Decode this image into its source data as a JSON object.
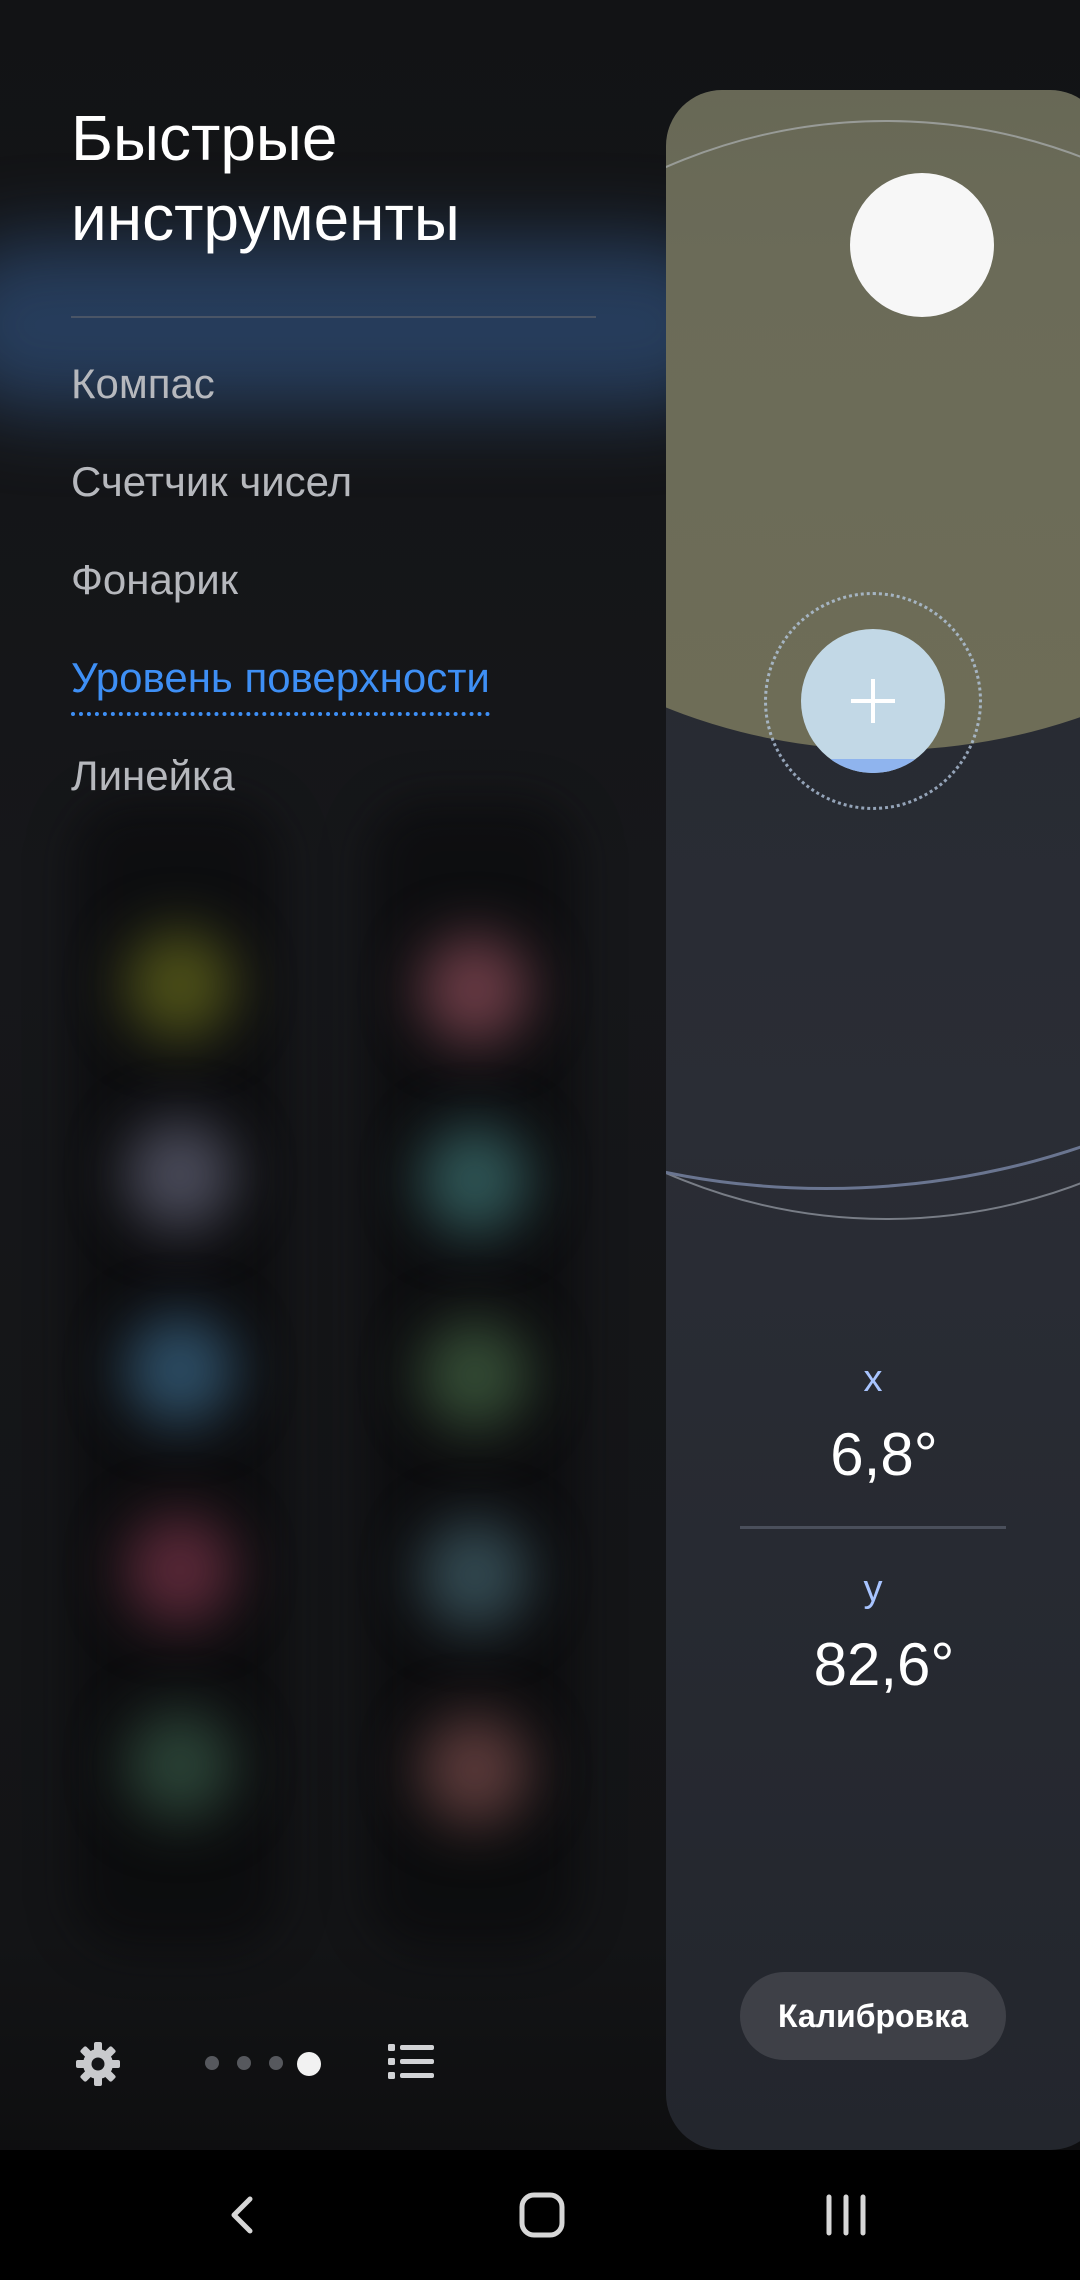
{
  "panel": {
    "title": "Быстрые инструменты",
    "tools": [
      {
        "label": "Компас",
        "active": false
      },
      {
        "label": "Счетчик чисел",
        "active": false
      },
      {
        "label": "Фонарик",
        "active": false
      },
      {
        "label": "Уровень поверхности",
        "active": true
      },
      {
        "label": "Линейка",
        "active": false
      }
    ],
    "settings_icon": "gear-icon",
    "list_icon": "list-icon",
    "page_indicator": {
      "total": 4,
      "current": 4
    }
  },
  "level_tool": {
    "x_label": "x",
    "x_value": "6,8°",
    "y_label": "y",
    "y_value": "82,6°",
    "calibrate_label": "Калибровка"
  },
  "nav_bar": {
    "back_icon": "back-icon",
    "home_icon": "home-icon",
    "recents_icon": "recents-icon"
  },
  "colors": {
    "accent": "#3e8ff5",
    "axis_label": "#a8c4ff",
    "horizon": "#6b6b58",
    "bubble": "#c2d8e6"
  }
}
